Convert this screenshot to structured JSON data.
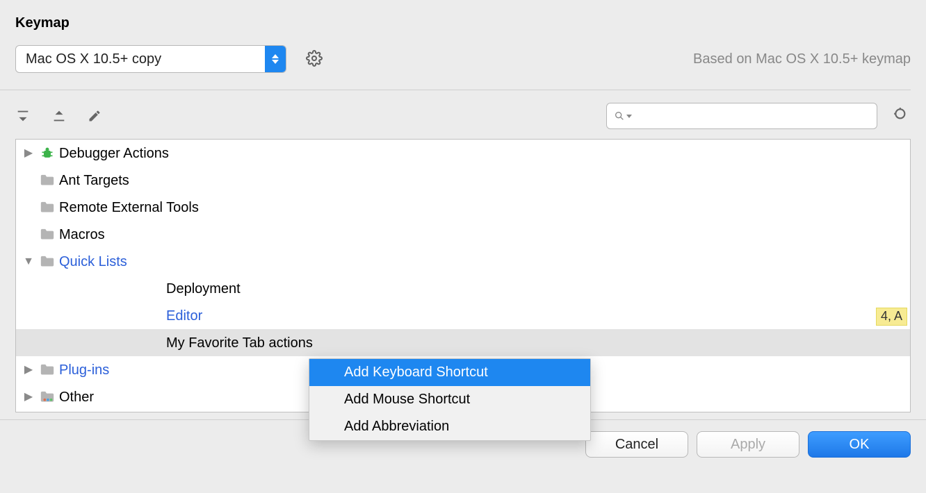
{
  "title": "Keymap",
  "selector": {
    "value": "Mac OS X 10.5+ copy"
  },
  "basedOn": "Based on Mac OS X 10.5+ keymap",
  "search": {
    "placeholder": ""
  },
  "tree": {
    "items": [
      {
        "label": "Debugger Actions",
        "disclosure": "closed",
        "icon": "bug",
        "link": false
      },
      {
        "label": "Ant Targets",
        "disclosure": "",
        "icon": "folder-ant",
        "link": false
      },
      {
        "label": "Remote External Tools",
        "disclosure": "",
        "icon": "folder-remote",
        "link": false
      },
      {
        "label": "Macros",
        "disclosure": "",
        "icon": "folder",
        "link": false
      },
      {
        "label": "Quick Lists",
        "disclosure": "open",
        "icon": "folder",
        "link": true
      },
      {
        "label": "Deployment",
        "disclosure": "",
        "icon": "",
        "link": false,
        "indent": 2
      },
      {
        "label": "Editor",
        "disclosure": "",
        "icon": "",
        "link": true,
        "indent": 2,
        "badge": "4, A"
      },
      {
        "label": "My Favorite Tab actions",
        "disclosure": "",
        "icon": "",
        "link": false,
        "indent": 2,
        "selected": true
      },
      {
        "label": "Plug-ins",
        "disclosure": "closed",
        "icon": "folder",
        "link": true
      },
      {
        "label": "Other",
        "disclosure": "closed",
        "icon": "folder-color",
        "link": false
      }
    ]
  },
  "contextMenu": {
    "items": [
      {
        "label": "Add Keyboard Shortcut",
        "highlight": true
      },
      {
        "label": "Add Mouse Shortcut",
        "highlight": false
      },
      {
        "label": "Add Abbreviation",
        "highlight": false
      }
    ]
  },
  "buttons": {
    "cancel": "Cancel",
    "apply": "Apply",
    "ok": "OK"
  }
}
